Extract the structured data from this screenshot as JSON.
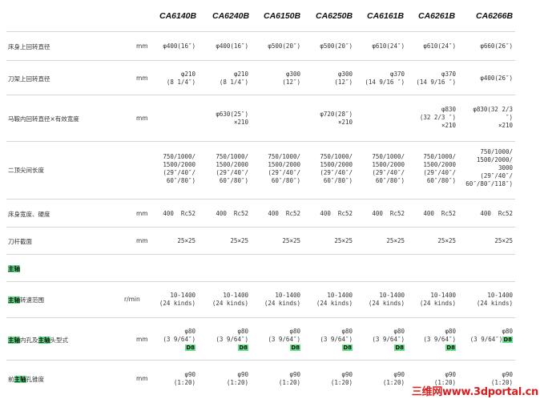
{
  "models": [
    "CA6140B",
    "CA6240B",
    "CA6150B",
    "CA6250B",
    "CA6161B",
    "CA6261B",
    "CA6266B"
  ],
  "rows": [
    {
      "label": "床身上回转直径",
      "unit": "mm",
      "cells": [
        "φ400(16″)",
        "φ400(16″)",
        "φ500(20″)",
        "φ500(20″)",
        "φ610(24″)",
        "φ610(24″)",
        "φ660(26″)"
      ]
    },
    {
      "label": "刀架上回转直径",
      "unit": "mm",
      "cells": [
        "φ210\n(8 1/4″)",
        "φ210\n(8 1/4″)",
        "φ300\n(12″)",
        "φ300\n(12″)",
        "φ370\n(14 9/16 ″)",
        "φ370\n(14 9/16 ″)",
        "φ400(26″)"
      ]
    },
    {
      "label": "马鞍内回转直径×有效宽度",
      "unit": "mm",
      "cells": [
        "",
        "φ630(25″)\n×210",
        "",
        "φ720(28″)\n×210",
        "",
        "φ830\n(32 2/3 ″)\n×210",
        "φ830(32 2/3\n″)\n×210"
      ]
    },
    {
      "label": "二顶尖间长度",
      "unit": "",
      "cells": [
        "750/1000/\n1500/2000\n(29″/40″/\n60″/80″)",
        "750/1000/\n1500/2000\n(29″/40″/\n60″/80″)",
        "750/1000/\n1500/2000\n(29″/40″/\n60″/80″)",
        "750/1000/\n1500/2000\n(29″/40″/\n60″/80″)",
        "750/1000/\n1500/2000\n(29″/40″/\n60″/80″)",
        "750/1000/\n1500/2000\n(29″/40″/\n60″/80″)",
        "750/1000/\n1500/2000/\n3000\n(29″/40″/\n60″/80″/118″)"
      ]
    },
    {
      "label": "床身宽度、硬度",
      "unit": "mm",
      "cells": [
        "400  Rc52",
        "400  Rc52",
        "400  Rc52",
        "400  Rc52",
        "400  Rc52",
        "400  Rc52",
        "400  Rc52"
      ]
    },
    {
      "label": "刀杆截面",
      "unit": "mm",
      "cells": [
        "25×25",
        "25×25",
        "25×25",
        "25×25",
        "25×25",
        "25×25",
        "25×25"
      ]
    }
  ],
  "section": {
    "title": "主轴"
  },
  "spindle_rows": [
    {
      "label_hl": "主轴",
      "label_rest": "转速范围",
      "unit": "r/min",
      "cells": [
        "10-1400\n(24 kinds)",
        "10-1400\n(24 kinds)",
        "10-1400\n(24 kinds)",
        "10-1400\n(24 kinds)",
        "10-1400\n(24 kinds)",
        "10-1400\n(24 kinds)",
        "10-1400\n(24 kinds)"
      ]
    },
    {
      "label_hl": "主轴",
      "label_mid": "内孔及",
      "label_hl2": "主轴",
      "label_rest": "头型式",
      "unit": "mm",
      "cells": [
        "φ80\n(3 9/64″)",
        "φ80\n(3 9/64″)",
        "φ80\n(3 9/64″)",
        "φ80\n(3 9/64″)",
        "φ80\n(3 9/64″)",
        "φ80\n(3 9/64″)",
        "φ80\n(3 9/64″)"
      ],
      "code": "D8"
    },
    {
      "label_pre": "前",
      "label_hl": "主轴",
      "label_rest": "孔锥度",
      "unit": "mm",
      "cells": [
        "φ90\n(1:20)",
        "φ90\n(1:20)",
        "φ90\n(1:20)",
        "φ90\n(1:20)",
        "φ90\n(1:20)",
        "φ90\n(1:20)",
        "φ90\n(1:20)"
      ]
    }
  ],
  "watermark": "三维网www.3dportal.cn"
}
